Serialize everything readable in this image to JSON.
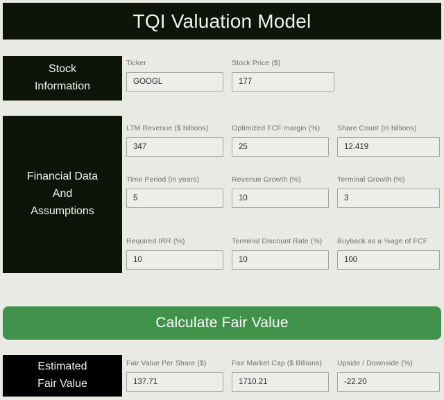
{
  "header": {
    "title": "TQI Valuation Model"
  },
  "colors": {
    "page_background": "#eaeae5",
    "panel_dark": "#0d1408",
    "panel_black": "#000000",
    "accent_green": "#40924a",
    "input_border": "#a3a49f",
    "label_text": "#6f706c"
  },
  "sections": [
    {
      "id": "stock-information",
      "label_lines": [
        "Stock",
        "Information"
      ],
      "rows": [
        {
          "fields": [
            {
              "label": "Ticker",
              "value": "GOOGL"
            },
            {
              "label": "Stock Price ($)",
              "value": "177"
            }
          ]
        }
      ]
    },
    {
      "id": "financial-data-and-assumptions",
      "label_lines": [
        "Financial Data",
        "And",
        "Assumptions"
      ],
      "rows": [
        {
          "fields": [
            {
              "label": "LTM Revenue ($ billions)",
              "value": "347"
            },
            {
              "label": "Optimized FCF margin (%)",
              "value": "25"
            },
            {
              "label": "Share Count (in billions)",
              "value": "12.419"
            }
          ]
        },
        {
          "fields": [
            {
              "label": "Time Period (in years)",
              "value": "5"
            },
            {
              "label": "Revenue Growth (%)",
              "value": "10"
            },
            {
              "label": "Terminal Growth (%)",
              "value": "3"
            }
          ]
        },
        {
          "fields": [
            {
              "label": "Required IRR (%)",
              "value": "10"
            },
            {
              "label": "Terminal Discount Rate (%)",
              "value": "10"
            },
            {
              "label": "Buyback as a %age of FCF",
              "value": "100"
            }
          ]
        }
      ]
    },
    {
      "id": "estimated-fair-value",
      "label_lines": [
        "Estimated",
        "Fair Value"
      ],
      "rows": [
        {
          "fields": [
            {
              "label": "Fair Value Per Share ($)",
              "value": "137.71"
            },
            {
              "label": "Fair Market Cap ($ Billions)",
              "value": "1710.21"
            },
            {
              "label": "Upside / Downside (%)",
              "value": "-22.20"
            }
          ]
        }
      ]
    }
  ],
  "calculate_button": {
    "label": "Calculate Fair Value"
  }
}
